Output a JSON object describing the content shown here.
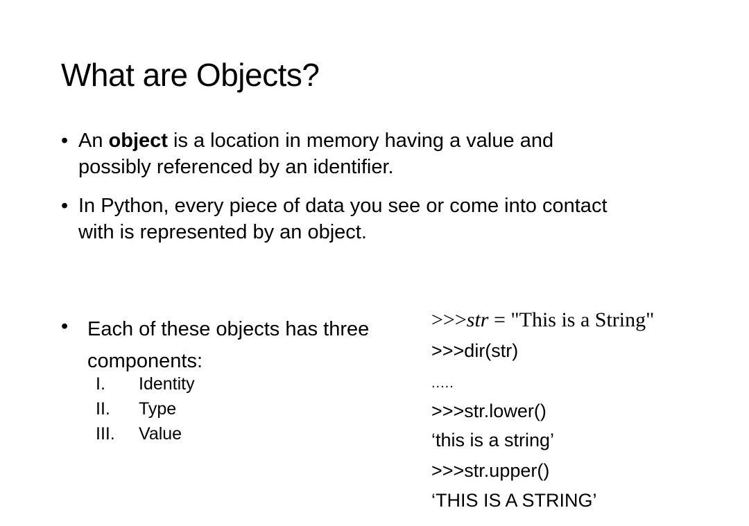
{
  "slide": {
    "title": "What are Objects?",
    "bullets": [
      {
        "bullet_glyph": "•",
        "line1_prefix": "An ",
        "line1_bold": "object",
        "line1_suffix": " is a location in memory having a value and",
        "line2": "possibly referenced by an identifier."
      },
      {
        "bullet_glyph": "•",
        "line1": "In Python, every piece of data you see or come into contact",
        "line2": "with is represented by an object."
      },
      {
        "bullet_glyph": "•",
        "line1": "Each of these objects has three",
        "line2": "components:",
        "sub_items": [
          {
            "num": "I.",
            "label": "Identity"
          },
          {
            "num": "II.",
            "label": "Type"
          },
          {
            "num": "III.",
            "label": "Value"
          }
        ]
      }
    ],
    "code": {
      "line1_prompt": ">>>",
      "line1_var": "str",
      "line1_rest": " = \"This is a String\"",
      "line2": ">>>dir(str)",
      "line3": ".....",
      "line4": ">>>str.lower()",
      "line5": "‘this is a string’",
      "line6": ">>>str.upper()",
      "line7": "‘THIS IS A STRING’"
    }
  }
}
